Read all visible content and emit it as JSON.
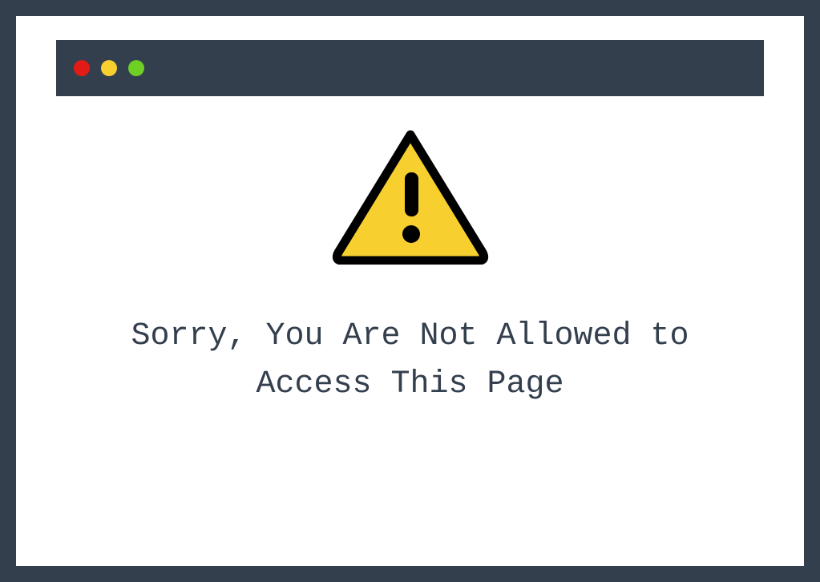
{
  "titlebar": {
    "controls": {
      "close": "red",
      "minimize": "yellow",
      "maximize": "green"
    }
  },
  "content": {
    "icon": "warning-triangle",
    "message": "Sorry, You Are Not Allowed to Access This Page"
  },
  "colors": {
    "frame": "#343f4e",
    "background": "#ffffff",
    "warning_fill": "#f7cf2f",
    "warning_stroke": "#000000",
    "dot_red": "#e21b17",
    "dot_yellow": "#f7cf2f",
    "dot_green": "#6ecf25",
    "text": "#343f4e"
  }
}
